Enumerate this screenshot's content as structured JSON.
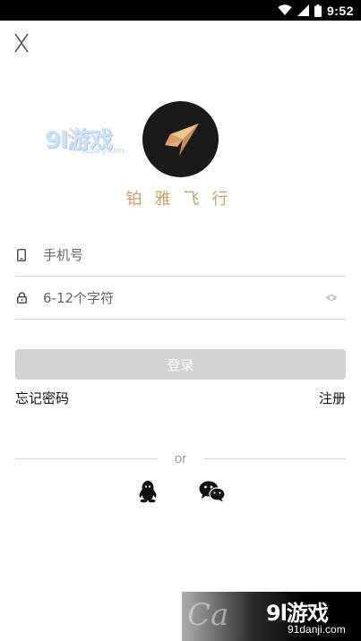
{
  "status_bar": {
    "time": "9:52",
    "icons": [
      "wifi-icon",
      "signal-icon",
      "battery-icon"
    ]
  },
  "header": {
    "close_icon": "close-icon"
  },
  "watermark_top": {
    "text": "9l游戏",
    "url": "91danji.com"
  },
  "app": {
    "logo_icon": "paper-plane-logo",
    "name": "铂雅飞行"
  },
  "form": {
    "phone": {
      "icon": "phone-icon",
      "placeholder": "手机号",
      "value": ""
    },
    "password": {
      "icon": "lock-icon",
      "placeholder": "6-12个字符",
      "value": "",
      "toggle_icon": "eye-icon"
    },
    "login_label": "登录",
    "forgot_label": "忘记密码",
    "register_label": "注册"
  },
  "social": {
    "divider_label": "or",
    "providers": [
      {
        "name": "QQ",
        "icon": "qq-icon"
      },
      {
        "name": "WeChat",
        "icon": "wechat-icon"
      }
    ]
  },
  "watermark_bottom": {
    "ghost_text": "Ca",
    "text": "9l游戏",
    "url": "91danji.com"
  },
  "colors": {
    "accent_gold": "#c9a26d",
    "button_disabled": "#d3d3d3",
    "divider": "#d9d9d9"
  }
}
